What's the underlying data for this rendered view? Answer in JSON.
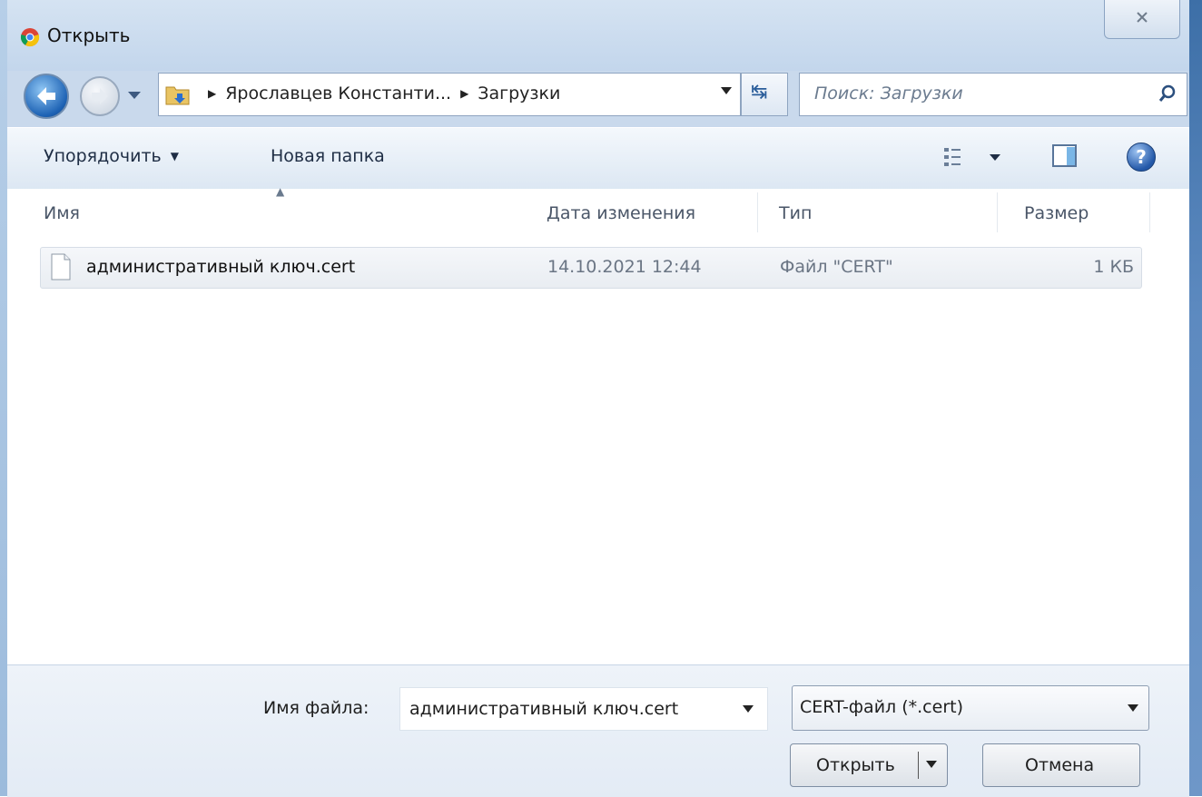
{
  "window": {
    "title": "Открыть"
  },
  "navigation": {
    "breadcrumb": [
      "Ярославцев Константи...",
      "Загрузки"
    ],
    "search_placeholder": "Поиск: Загрузки"
  },
  "toolbar": {
    "organize_label": "Упорядочить",
    "new_folder_label": "Новая папка"
  },
  "file_list": {
    "columns": [
      "Имя",
      "Дата изменения",
      "Тип",
      "Размер"
    ],
    "rows": [
      {
        "name": "административный ключ.cert",
        "modified": "14.10.2021 12:44",
        "type": "Файл \"CERT\"",
        "size": "1 КБ"
      }
    ]
  },
  "footer": {
    "filename_label": "Имя файла:",
    "filename_value": "административный ключ.cert",
    "filetype_value": "CERT-файл (*.cert)",
    "open_label": "Открыть",
    "cancel_label": "Отмена"
  }
}
